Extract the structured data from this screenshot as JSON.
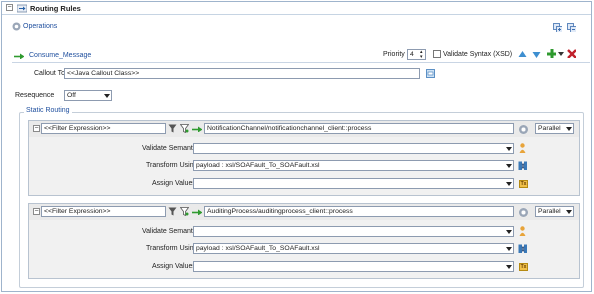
{
  "header": {
    "title": "Routing Rules"
  },
  "operations": {
    "label": "Operations"
  },
  "message": {
    "name": "Consume_Message",
    "priority_label": "Priority",
    "priority_value": "4",
    "validate_syntax_label": "Validate Syntax (XSD)",
    "callout_label": "Callout To",
    "callout_value": "<<Java Callout Class>>",
    "resequence_label": "Resequence",
    "resequence_value": "Off"
  },
  "static_routing": {
    "legend": "Static Routing",
    "routes": [
      {
        "filter": "<<Filter Expression>>",
        "target": "NotificationChannel/notificationchannel_client::process",
        "mode": "Parallel",
        "validate_label": "Validate Semantic",
        "validate_value": "",
        "transform_label": "Transform Using",
        "transform_value": "payload : xsl/SOAFault_To_SOAFault.xsl",
        "assign_label": "Assign Values",
        "assign_value": ""
      },
      {
        "filter": "<<Filter Expression>>",
        "target": "AuditingProcess/auditingprocess_client::process",
        "mode": "Parallel",
        "validate_label": "Validate Semantic",
        "validate_value": "",
        "transform_label": "Transform Using",
        "transform_value": "payload : xsl/SOAFault_To_SOAFault.xsl",
        "assign_label": "Assign Values",
        "assign_value": ""
      }
    ]
  },
  "colors": {
    "link": "#1f4f9e",
    "panel_bg": "#f1f1f1",
    "delete_red": "#c0202b",
    "add_green": "#2f9a2f"
  },
  "icons": [
    "collapse-icon",
    "operations-gear-icon",
    "expand-all-icon",
    "collapse-all-icon",
    "route-arrow-icon",
    "move-up-icon",
    "move-down-icon",
    "add-icon",
    "add-menu-icon",
    "delete-icon",
    "class-browse-icon",
    "filter-edit-icon",
    "filter-builder-icon",
    "settings-icon",
    "schema-icon",
    "transform-icon",
    "assign-icon"
  ]
}
